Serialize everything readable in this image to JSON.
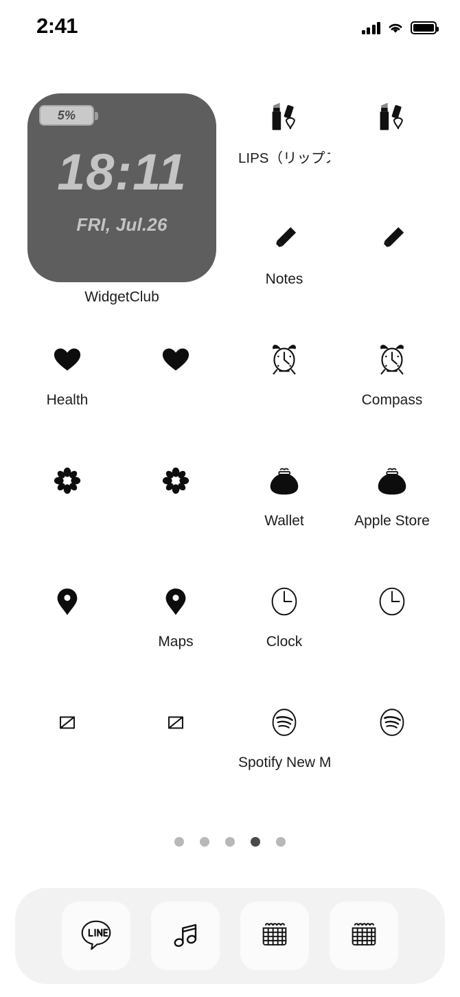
{
  "status_bar": {
    "time": "2:41",
    "signal_icon": "cellular-signal-icon",
    "wifi_icon": "wifi-icon",
    "battery_icon": "battery-full-icon"
  },
  "widget": {
    "battery_badge": "5%",
    "clock": "18:11",
    "date": "FRI, Jul.26",
    "label": "WidgetClub",
    "background_color": "#5e5e5e",
    "text_color": "#c4c4c4"
  },
  "grid": {
    "rows": [
      {
        "cells": [
          {
            "icon": "",
            "label": "",
            "occupied_by_widget": true
          },
          {
            "icon": "",
            "label": "",
            "occupied_by_widget": true
          },
          {
            "icon": "lipstick-icon",
            "label": "LIPS（リップス）"
          },
          {
            "icon": "lipstick-icon",
            "label": ""
          }
        ]
      },
      {
        "cells": [
          {
            "icon": "",
            "label": "",
            "occupied_by_widget": true
          },
          {
            "icon": "",
            "label": "",
            "occupied_by_widget": true
          },
          {
            "icon": "pencil-icon",
            "label": "Notes"
          },
          {
            "icon": "pencil-icon",
            "label": ""
          }
        ]
      },
      {
        "cells": [
          {
            "icon": "heart-icon",
            "label": "Health"
          },
          {
            "icon": "heart-icon",
            "label": ""
          },
          {
            "icon": "alarm-clock-icon",
            "label": ""
          },
          {
            "icon": "alarm-clock-icon",
            "label": "Compass"
          }
        ]
      },
      {
        "cells": [
          {
            "icon": "flower-icon",
            "label": ""
          },
          {
            "icon": "flower-icon",
            "label": ""
          },
          {
            "icon": "coin-purse-icon",
            "label": "Wallet"
          },
          {
            "icon": "coin-purse-icon",
            "label": "Apple Store"
          }
        ]
      },
      {
        "cells": [
          {
            "icon": "map-pin-icon",
            "label": ""
          },
          {
            "icon": "map-pin-icon",
            "label": "Maps"
          },
          {
            "icon": "clock-outline-icon",
            "label": "Clock"
          },
          {
            "icon": "clock-outline-icon",
            "label": ""
          }
        ]
      },
      {
        "cells": [
          {
            "icon": "hourglass-icon",
            "label": ""
          },
          {
            "icon": "hourglass-icon",
            "label": ""
          },
          {
            "icon": "spotify-icon",
            "label": "Spotify New M"
          },
          {
            "icon": "spotify-icon",
            "label": ""
          }
        ]
      }
    ]
  },
  "page_indicator": {
    "total": 5,
    "active_index": 4
  },
  "dock": {
    "items": [
      {
        "icon": "line-chat-icon",
        "label": "LINE"
      },
      {
        "icon": "music-note-icon",
        "label": ""
      },
      {
        "icon": "calendar-icon",
        "label": ""
      },
      {
        "icon": "calendar-icon",
        "label": ""
      }
    ]
  }
}
